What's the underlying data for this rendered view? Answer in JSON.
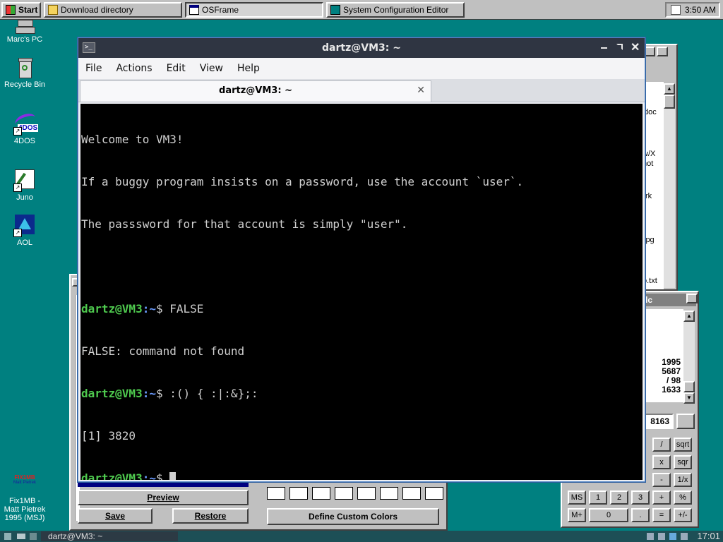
{
  "taskbar_top": {
    "start_label": "Start",
    "tasks": [
      {
        "label": "Download directory",
        "icon": "folder-icon"
      },
      {
        "label": "OSFrame",
        "icon": "window-icon"
      },
      {
        "label": "System Configuration Editor",
        "icon": "sysedit-icon"
      }
    ],
    "clock": "3:50 AM"
  },
  "desktop_icons": [
    {
      "label": "Marc's PC",
      "icon": "computer-icon"
    },
    {
      "label": "Recycle Bin",
      "icon": "recycle-bin-icon"
    },
    {
      "label": "4DOS",
      "icon": "4dos-icon",
      "glyph_text": "4DOS"
    },
    {
      "label": "Juno",
      "icon": "juno-icon"
    },
    {
      "label": "AOL",
      "icon": "aol-icon"
    }
  ],
  "fix1mb": {
    "logo_text": "FIX1MB",
    "logo_sub": "Matt Pietrek",
    "label": "Fix1MB - Matt Pietrek 1995 (MSJ)"
  },
  "file_window": {
    "fragments": [
      "doc",
      "w/X",
      "not",
      "rk",
      "jpg",
      "o.txt"
    ]
  },
  "calculator": {
    "title_fragment": "lc",
    "list_fragments": [
      "1995",
      "5687",
      "/ 98",
      "1633"
    ],
    "display": "8163",
    "keys": [
      "/",
      "sqrt",
      "x",
      "sqr",
      "-",
      "1/x",
      "MS",
      "1",
      "2",
      "3",
      "+",
      "%",
      "M+",
      "0",
      ".",
      "=",
      "+/-"
    ]
  },
  "color_dialog": {
    "preview_label": "Preview",
    "save_label": "Save",
    "restore_label": "Restore",
    "define_label": "Define Custom Colors"
  },
  "terminal": {
    "title": "dartz@VM3: ~",
    "menu": [
      "File",
      "Actions",
      "Edit",
      "View",
      "Help"
    ],
    "tab_label": "dartz@VM3: ~",
    "lines": {
      "l1": "Welcome to VM3!",
      "l2": "If a buggy program insists on a password, use the account `user`.",
      "l3": "The passsword for that account is simply \"user\".",
      "p_user": "dartz@VM3",
      "p_path": ":~",
      "p_sign": "$ ",
      "cmd1": "FALSE",
      "out1": "FALSE: command not found",
      "cmd2": ":() { :|:&};:",
      "out2": "[1] 3820"
    }
  },
  "taskbar_bottom": {
    "task_label": "dartz@VM3: ~",
    "clock": "17:01"
  },
  "colors": {
    "desktop": "#008080",
    "terminal_bg": "#000000",
    "prompt_user": "#4ec94e",
    "prompt_path": "#6b9cff",
    "titlebar": "#2f3542"
  }
}
